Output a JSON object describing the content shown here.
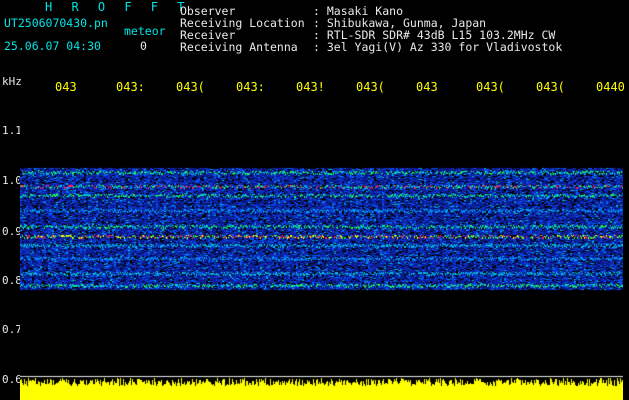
{
  "header": {
    "title": "H R O F F T",
    "filename": "UT2506070430.pn",
    "meteor_label": "meteor",
    "timestamp": "25.06.07 04:30",
    "count": "0",
    "fields": [
      {
        "label": "Observer",
        "value": ": Masaki Kano"
      },
      {
        "label": "Receiving Location",
        "value": ": Shibukawa, Gunma, Japan"
      },
      {
        "label": "Receiver",
        "value": ": RTL-SDR SDR# 43dB L15 103.2MHz CW"
      },
      {
        "label": "Receiving Antenna",
        "value": ": 3el Yagi(V) Az 330 for Vladivostok"
      }
    ]
  },
  "axis": {
    "unit": "kHz",
    "time_ticks": [
      "043",
      "043:",
      "043(",
      "043:",
      "043!",
      "043(",
      "043",
      "043(",
      "043(",
      "0440"
    ],
    "freq_ticks": [
      "1.1",
      "1.0",
      "0.9",
      "0.8",
      "0.7",
      "0.6"
    ]
  },
  "colors": {
    "background": "#000000",
    "header_text": "#00e5e5",
    "tick_text": "#ffff00",
    "signal_bar": "#ffff00"
  }
}
